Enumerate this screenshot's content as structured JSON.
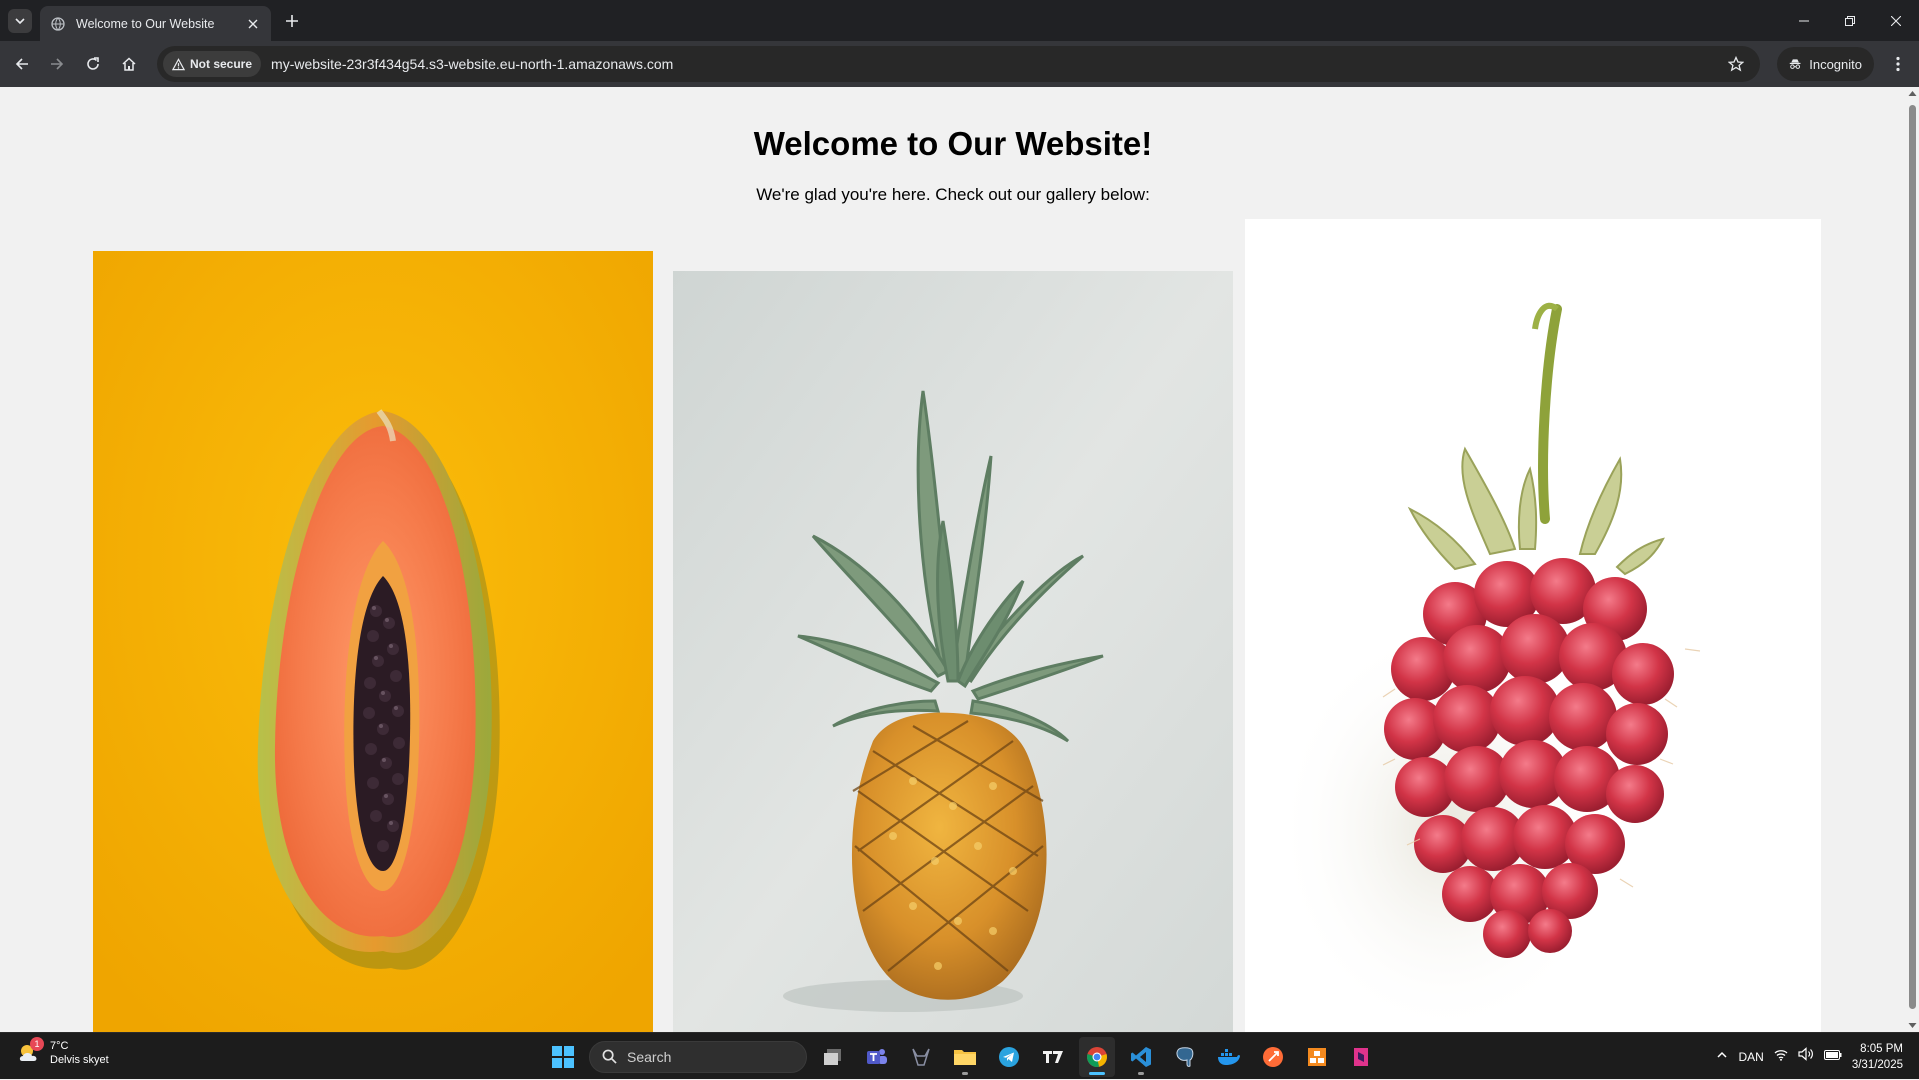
{
  "browser": {
    "tab_title": "Welcome to Our Website",
    "security_label": "Not secure",
    "url": "my-website-23r3f434g54.s3-website.eu-north-1.amazonaws.com",
    "profile_label": "Incognito"
  },
  "page": {
    "title": "Welcome to Our Website!",
    "subtitle": "We're glad you're here. Check out our gallery below:",
    "gallery": [
      {
        "subject": "papaya",
        "background": "#f6b300"
      },
      {
        "subject": "pineapple",
        "background": "#d6dad9"
      },
      {
        "subject": "raspberry",
        "background": "#ffffff"
      }
    ]
  },
  "taskbar": {
    "weather_badge": "1",
    "weather_temp": "7°C",
    "weather_desc": "Delvis skyet",
    "search_placeholder": "Search",
    "language": "DAN",
    "time": "8:05 PM",
    "date": "3/31/2025",
    "apps": [
      "task-view",
      "teams",
      "alienware",
      "file-explorer",
      "telegram",
      "typora",
      "chrome",
      "vscode",
      "postgresql",
      "docker",
      "postman",
      "tailscale",
      "notion-like"
    ]
  },
  "colors": {
    "chrome_dark": "#202124",
    "toolbar": "#35363a",
    "page_bg": "#f1f1f1",
    "accent": "#4cc2ff"
  }
}
